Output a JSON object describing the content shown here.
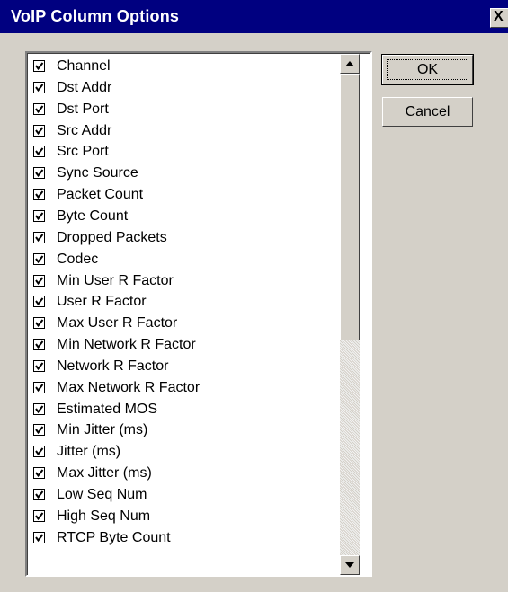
{
  "window": {
    "title": "VoIP Column Options",
    "close_label": "X"
  },
  "columns": [
    {
      "label": "Channel",
      "checked": true
    },
    {
      "label": "Dst Addr",
      "checked": true
    },
    {
      "label": "Dst Port",
      "checked": true
    },
    {
      "label": "Src Addr",
      "checked": true
    },
    {
      "label": "Src Port",
      "checked": true
    },
    {
      "label": "Sync Source",
      "checked": true
    },
    {
      "label": "Packet Count",
      "checked": true
    },
    {
      "label": "Byte Count",
      "checked": true
    },
    {
      "label": "Dropped Packets",
      "checked": true
    },
    {
      "label": "Codec",
      "checked": true
    },
    {
      "label": "Min User R Factor",
      "checked": true
    },
    {
      "label": "User R Factor",
      "checked": true
    },
    {
      "label": "Max User R Factor",
      "checked": true
    },
    {
      "label": "Min Network R Factor",
      "checked": true
    },
    {
      "label": "Network R Factor",
      "checked": true
    },
    {
      "label": "Max Network R Factor",
      "checked": true
    },
    {
      "label": "Estimated MOS",
      "checked": true
    },
    {
      "label": "Min Jitter (ms)",
      "checked": true
    },
    {
      "label": "Jitter (ms)",
      "checked": true
    },
    {
      "label": "Max Jitter (ms)",
      "checked": true
    },
    {
      "label": "Low Seq Num",
      "checked": true
    },
    {
      "label": "High Seq Num",
      "checked": true
    },
    {
      "label": "RTCP Byte Count",
      "checked": true
    }
  ],
  "buttons": {
    "ok_label": "OK",
    "cancel_label": "Cancel"
  },
  "colors": {
    "titlebar": "#000080",
    "dialog_face": "#d4d0c8"
  }
}
